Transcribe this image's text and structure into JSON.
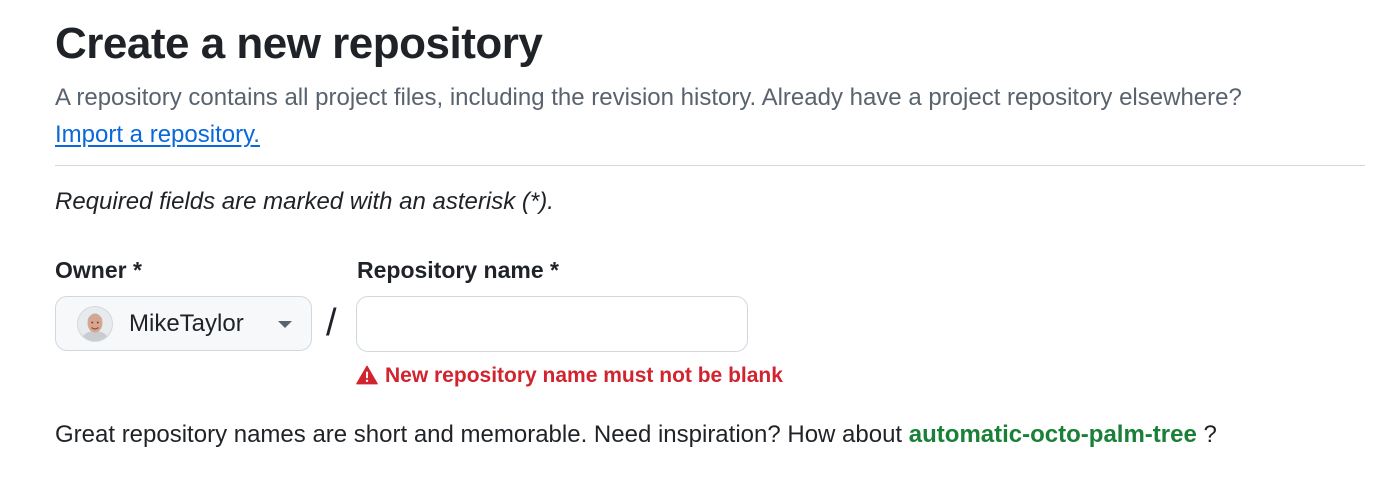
{
  "header": {
    "title": "Create a new repository",
    "subtitle": "A repository contains all project files, including the revision history. Already have a project repository elsewhere?",
    "import_link": "Import a repository."
  },
  "form": {
    "required_note": "Required fields are marked with an asterisk (*).",
    "owner": {
      "label": "Owner *",
      "selected": "MikeTaylor",
      "icon": "chevron-down-icon"
    },
    "separator": "/",
    "repository_name": {
      "label": "Repository name *",
      "value": "",
      "placeholder": ""
    },
    "error": {
      "icon": "alert-icon",
      "message": "New repository name must not be blank",
      "color": "#d1242f"
    },
    "suggestion": {
      "prefix": "Great repository names are short and memorable. Need inspiration? How about",
      "name": "automatic-octo-palm-tree",
      "suffix": "?"
    }
  },
  "colors": {
    "link": "#0969da",
    "muted_text": "#59636e",
    "suggestion_green": "#1a7f37",
    "border": "#d1d9e0"
  }
}
